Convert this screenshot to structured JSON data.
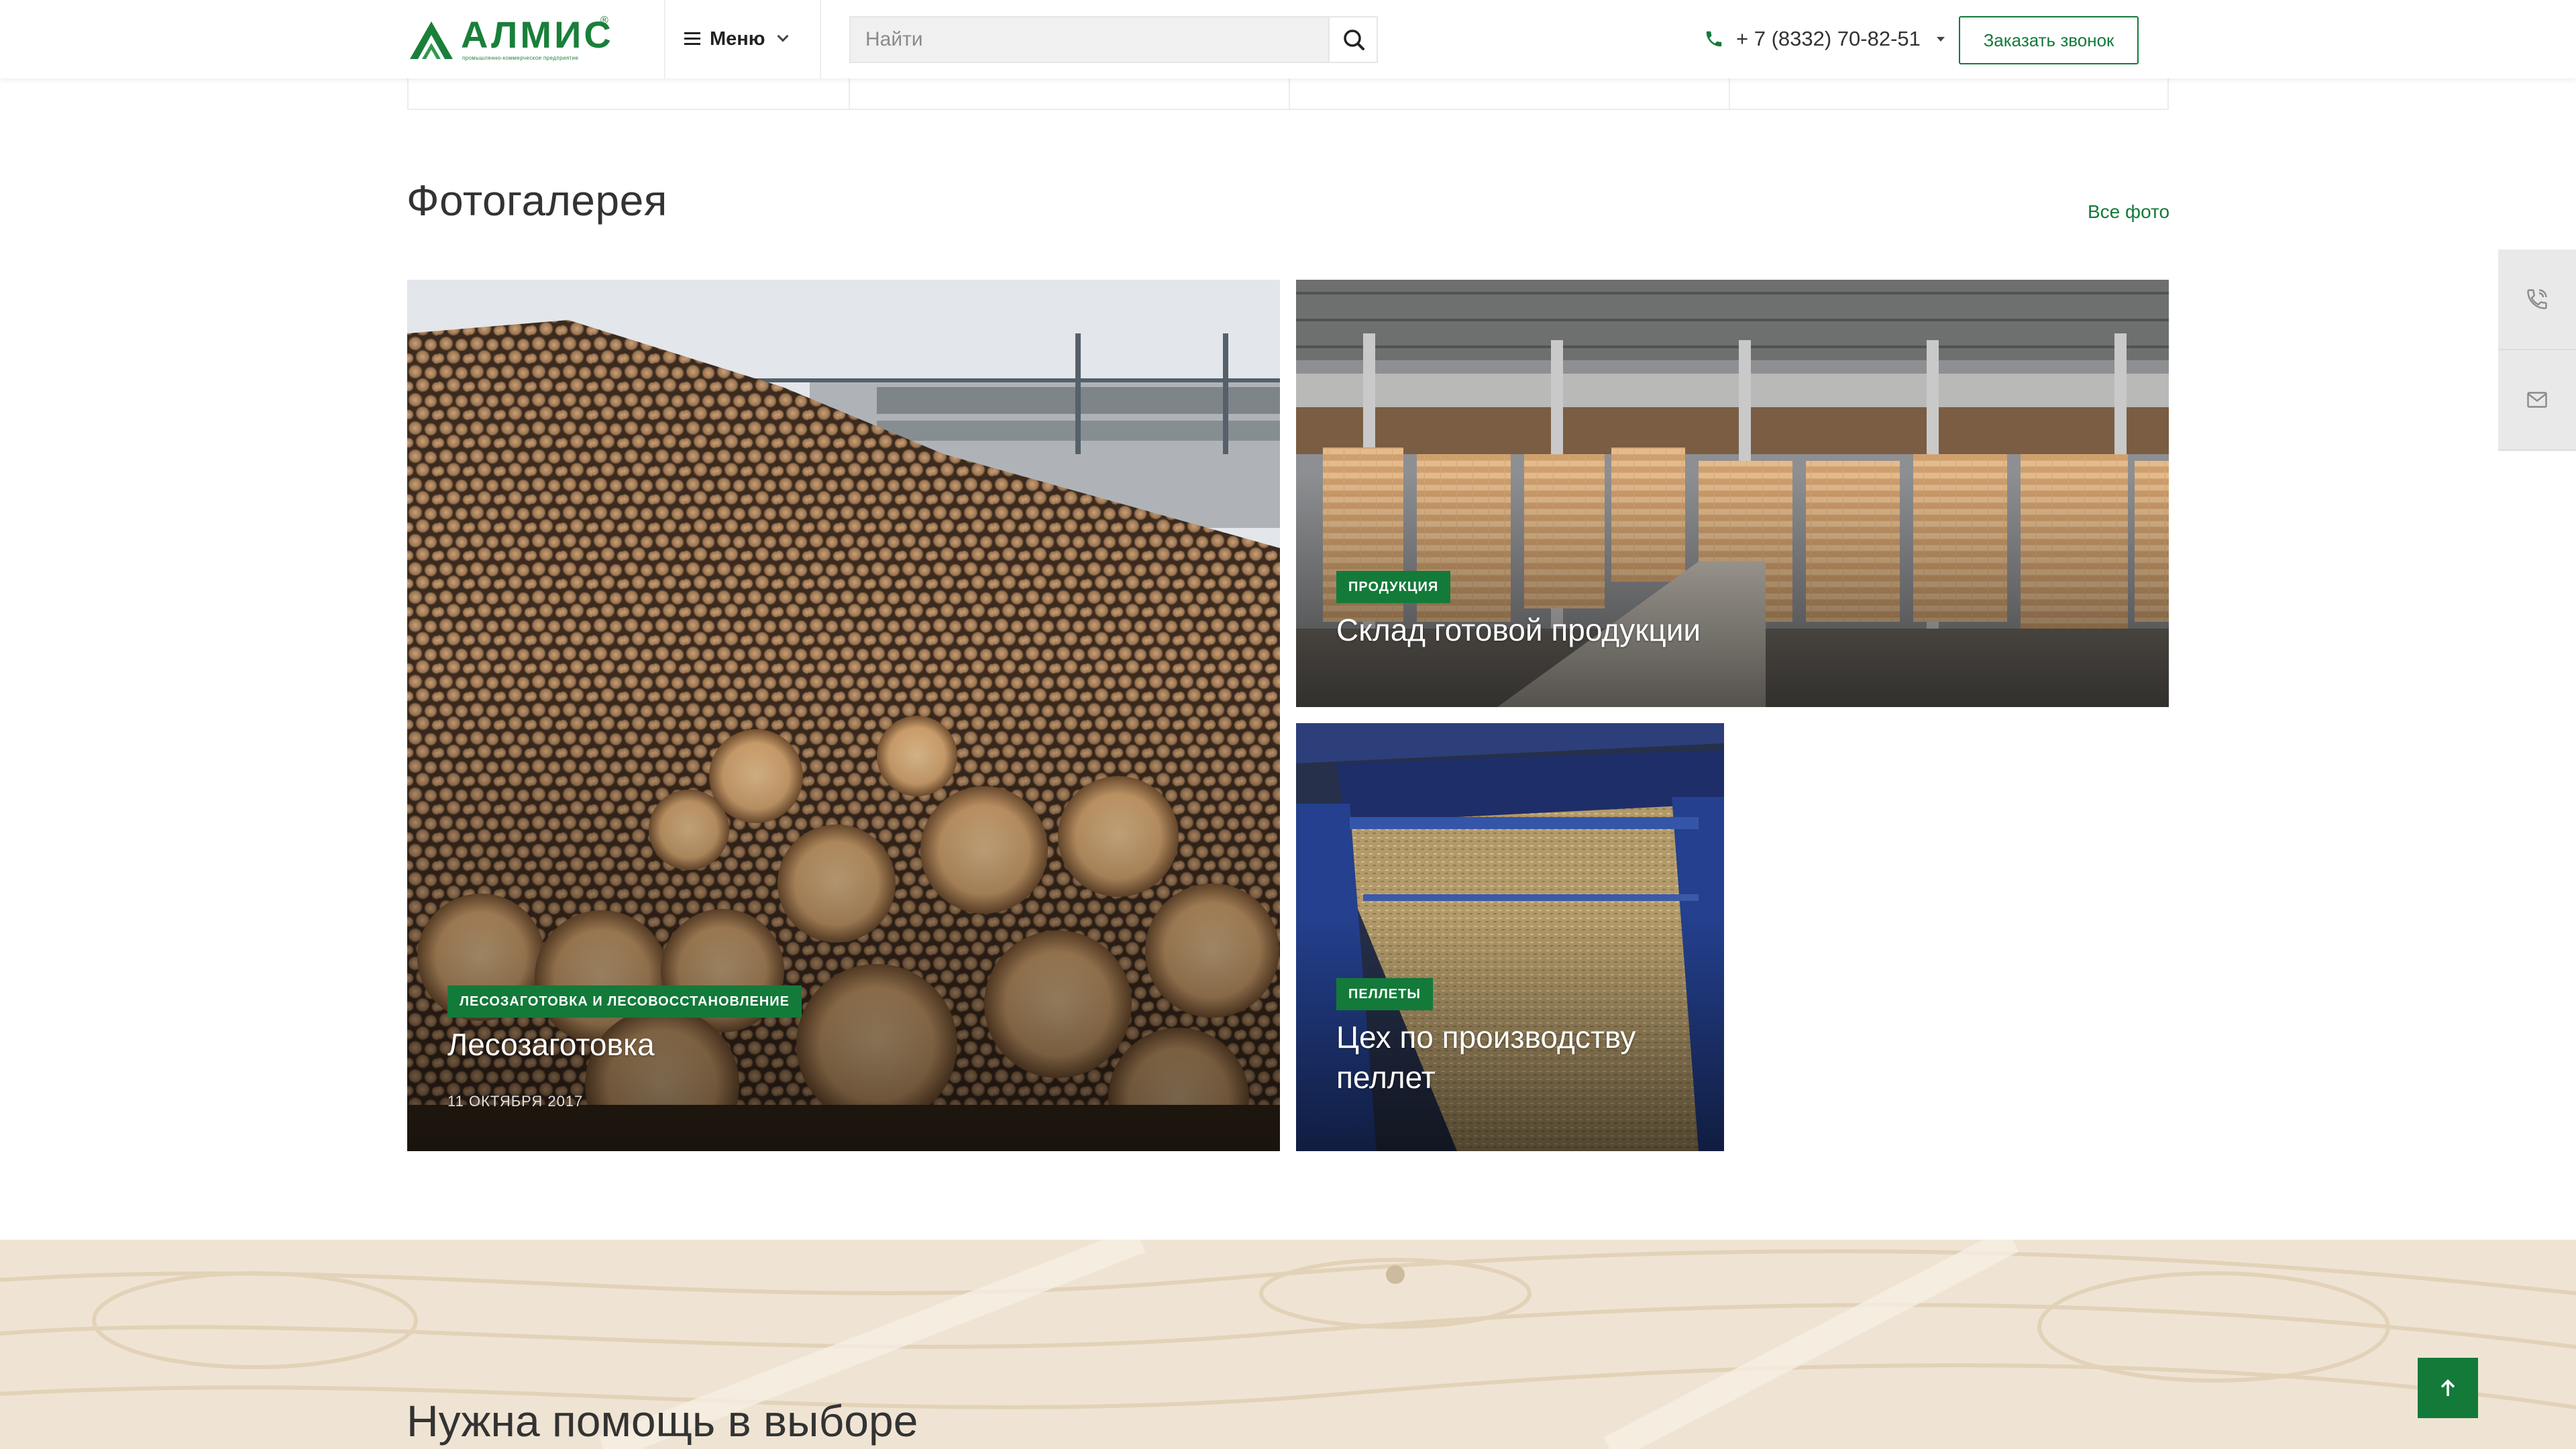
{
  "header": {
    "logo_text": "АЛМИС",
    "logo_subtitle": "промышленно-коммерческое предприятие",
    "logo_reg": "®",
    "menu_label": "Меню",
    "search_placeholder": "Найти",
    "phone": "+ 7 (8332) 70-82-51",
    "call_button": "Заказать звонок"
  },
  "gallery": {
    "title": "Фотогалерея",
    "all_photos_link": "Все фото",
    "items": [
      {
        "tag": "ЛЕСОЗАГОТОВКА И ЛЕСОВОССТАНОВЛЕНИЕ",
        "title": "Лесозаготовка",
        "date": "11 ОКТЯБРЯ 2017"
      },
      {
        "tag": "ПРОДУКЦИЯ",
        "title": "Склад готовой продукции"
      },
      {
        "tag": "ПЕЛЛЕТЫ",
        "title_line1": "Цех по производству",
        "title_line2": "пеллет"
      }
    ]
  },
  "help": {
    "title": "Нужна помощь в выборе"
  },
  "icons": {
    "logo": "almis-logo-icon",
    "menu": "menu-icon",
    "search": "search-icon",
    "phone": "phone-icon",
    "side_call": "phone-callback-icon",
    "side_mail": "mail-icon",
    "scroll_top": "arrow-up-icon"
  },
  "colors": {
    "brand_green": "#137a3a",
    "text_dark": "#333333",
    "side_panel": "#e9e9e9"
  }
}
